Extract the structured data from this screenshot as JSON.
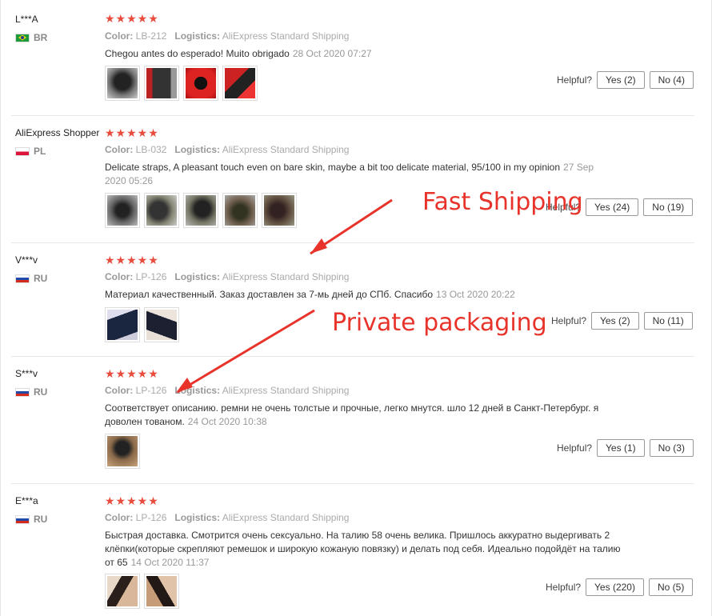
{
  "labels": {
    "color": "Color:",
    "logistics": "Logistics:",
    "helpful": "Helpful?"
  },
  "stars": "★★★★★",
  "reviews": [
    {
      "user": "L***A",
      "country": "BR",
      "color": "LB-212",
      "logistics": "AliExpress Standard Shipping",
      "text": "Chegou antes do esperado! Muito obrigado",
      "date": "28 Oct 2020 07:27",
      "yes": "Yes (2)",
      "no": "No (4)"
    },
    {
      "user": "AliExpress Shopper",
      "country": "PL",
      "color": "LB-032",
      "logistics": "AliExpress Standard Shipping",
      "text": "Delicate straps, A pleasant touch even on bare skin, maybe a bit too delicate material, 95/100 in my opinion",
      "date": "27 Sep 2020 05:26",
      "yes": "Yes (24)",
      "no": "No (19)"
    },
    {
      "user": "V***v",
      "country": "RU",
      "color": "LP-126",
      "logistics": "AliExpress Standard Shipping",
      "text": "Материал качественный. Заказ доставлен за 7-мь дней до СПб. Спасибо",
      "date": "13 Oct 2020 20:22",
      "yes": "Yes (2)",
      "no": "No (11)"
    },
    {
      "user": "S***v",
      "country": "RU",
      "color": "LP-126",
      "logistics": "AliExpress Standard Shipping",
      "text": "Соответствует описанию. ремни не очень толстые и прочные, легко мнутся. шло 12 дней в Санкт-Петербург. я доволен тованом.",
      "date": "24 Oct 2020 10:38",
      "yes": "Yes (1)",
      "no": "No (3)"
    },
    {
      "user": "E***a",
      "country": "RU",
      "color": "LP-126",
      "logistics": "AliExpress Standard Shipping",
      "text": "Быстрая доставка. Смотрится очень сексуально. На талию 58 очень велика. Пришлось аккуратно выдергивать 2 клёпки(которые скрепляют ремешок и широкую кожаную повязку) и делать под себя. Идеально подойдёт на талию от 65",
      "date": "14 Oct 2020 11:37",
      "yes": "Yes (220)",
      "no": "No (5)"
    }
  ],
  "annotations": {
    "fast": "Fast Shipping",
    "private": "Private packaging"
  },
  "colors": {
    "star": "#e94b3c",
    "annotation": "#e8332b"
  }
}
